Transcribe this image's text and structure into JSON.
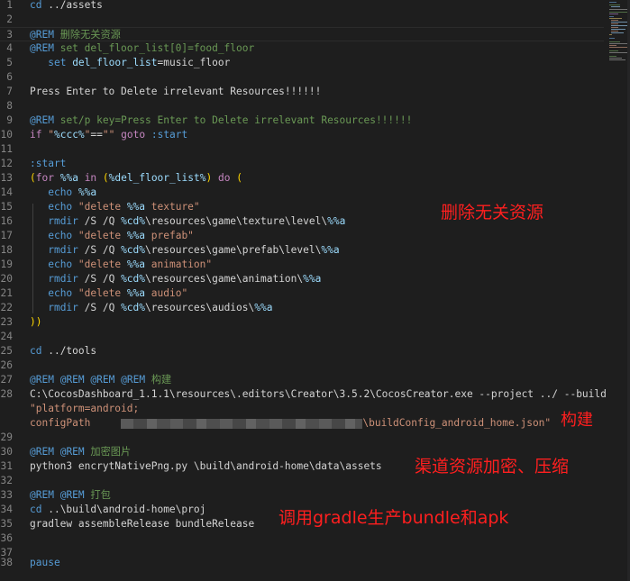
{
  "editor": {
    "lines": [
      {
        "no": "1",
        "code": "cd ../assets"
      },
      {
        "no": "2",
        "code": ""
      },
      {
        "no": "3",
        "code": "@REM 删除无关资源"
      },
      {
        "no": "4",
        "code": "@REM set del_floor_list[0]=food_floor"
      },
      {
        "no": "5",
        "code": "set del_floor_list=music_floor"
      },
      {
        "no": "6",
        "code": ""
      },
      {
        "no": "7",
        "code": "Press Enter to Delete irrelevant Resources!!!!!!"
      },
      {
        "no": "8",
        "code": ""
      },
      {
        "no": "9",
        "code": "@REM set/p key=Press Enter to Delete irrelevant Resources!!!!!!"
      },
      {
        "no": "10",
        "code": "if \"%ccc%\"==\"\" goto :start"
      },
      {
        "no": "11",
        "code": ""
      },
      {
        "no": "12",
        "code": ":start"
      },
      {
        "no": "13",
        "code": "(for %%a in (%del_floor_list%) do ("
      },
      {
        "no": "14",
        "code": "echo %%a"
      },
      {
        "no": "15",
        "code": "echo \"delete %%a texture\""
      },
      {
        "no": "16",
        "code": "rmdir /S /Q %cd%\\resources\\game\\texture\\level\\%%a"
      },
      {
        "no": "17",
        "code": "echo \"delete %%a prefab\""
      },
      {
        "no": "18",
        "code": "rmdir /S /Q %cd%\\resources\\game\\prefab\\level\\%%a"
      },
      {
        "no": "19",
        "code": "echo \"delete %%a animation\""
      },
      {
        "no": "20",
        "code": "rmdir /S /Q %cd%\\resources\\game\\animation\\%%a"
      },
      {
        "no": "21",
        "code": "echo \"delete %%a audio\""
      },
      {
        "no": "22",
        "code": "rmdir /S /Q %cd%\\resources\\audios\\%%a"
      },
      {
        "no": "23",
        "code": "))"
      },
      {
        "no": "24",
        "code": ""
      },
      {
        "no": "25",
        "code": "cd ../tools"
      },
      {
        "no": "26",
        "code": ""
      },
      {
        "no": "27",
        "code": "@REM @REM @REM @REM 构建"
      },
      {
        "no": "28",
        "code": "C:\\CocosDashboard_1.1.1\\resources\\.editors\\Creator\\3.5.2\\CocosCreator.exe --project ../ --build"
      },
      {
        "no": "",
        "code": "\"platform=android;"
      },
      {
        "no": "",
        "code": "configPath"
      },
      {
        "no": "29",
        "code": ""
      },
      {
        "no": "30",
        "code": "@REM @REM 加密图片"
      },
      {
        "no": "31",
        "code": "python3 encrytNativePng.py \\build\\android-home\\data\\assets"
      },
      {
        "no": "32",
        "code": ""
      },
      {
        "no": "33",
        "code": "@REM @REM 打包"
      },
      {
        "no": "34",
        "code": "cd ..\\build\\android-home\\proj"
      },
      {
        "no": "35",
        "code": "gradlew assembleRelease bundleRelease"
      },
      {
        "no": "36",
        "code": ""
      },
      {
        "no": "37",
        "code": ""
      },
      {
        "no": "38",
        "code": "pause"
      }
    ],
    "config_path_tail": "\\buildConfig_android_home.json\""
  },
  "annotations": {
    "delete": "删除无关资源",
    "build": "构建",
    "encrypt": "渠道资源加密、压缩",
    "package": "调用gradle生产bundle和apk"
  },
  "colors": {
    "background": "#1e1e1e",
    "keyword": "#569cd6",
    "string": "#ce9178",
    "variable": "#9cdcfe",
    "comment": "#6a9955",
    "control": "#c586c0",
    "annotation": "#ff1f1f"
  }
}
